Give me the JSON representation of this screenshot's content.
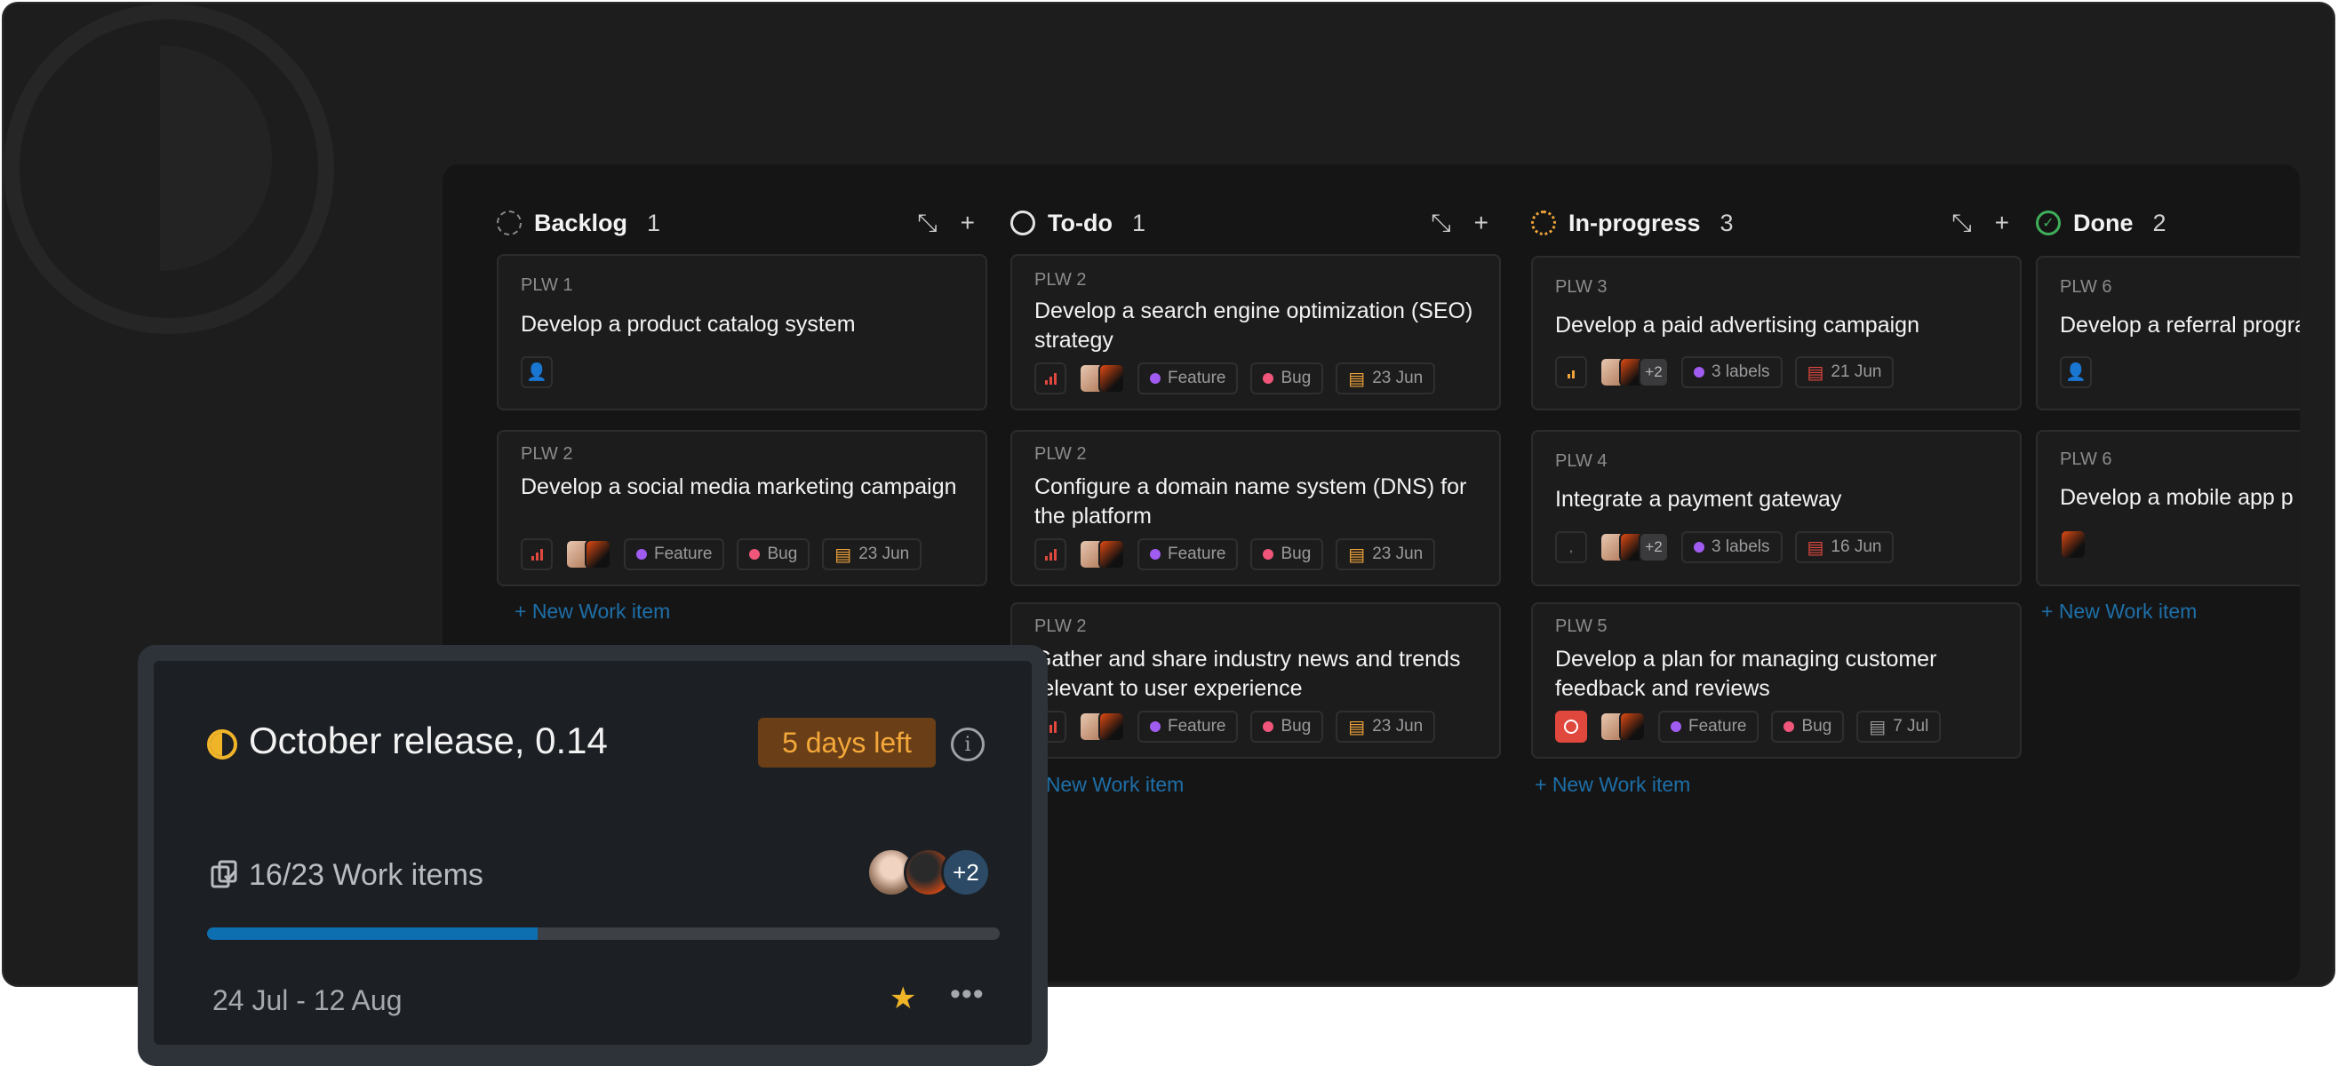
{
  "columns": [
    {
      "title": "Backlog",
      "count": "1",
      "state": "backlog",
      "cards": [
        {
          "id": "PLW 1",
          "title": "Develop a product catalog system"
        },
        {
          "id": "PLW 2",
          "title": "Develop a social media marketing campaign",
          "feature": "Feature",
          "bug": "Bug",
          "date": "23 Jun"
        }
      ],
      "new_item": "+ New Work item"
    },
    {
      "title": "To-do",
      "count": "1",
      "state": "todo",
      "cards": [
        {
          "id": "PLW 2",
          "title": "Develop a search engine optimization (SEO) strategy",
          "feature": "Feature",
          "bug": "Bug",
          "date": "23 Jun"
        },
        {
          "id": "PLW 2",
          "title": "Configure a domain name system (DNS) for the platform",
          "feature": "Feature",
          "bug": "Bug",
          "date": "23 Jun"
        },
        {
          "id": "PLW 2",
          "title": "Gather and share industry news and trends relevant to user experience",
          "feature": "Feature",
          "bug": "Bug",
          "date": "23 Jun"
        }
      ],
      "new_item": "+ New Work item"
    },
    {
      "title": "In-progress",
      "count": "3",
      "state": "inprogress",
      "cards": [
        {
          "id": "PLW 3",
          "title": "Develop a paid advertising campaign",
          "more": "+2",
          "labels": "3 labels",
          "date": "21 Jun"
        },
        {
          "id": "PLW 4",
          "title": "Integrate a payment gateway",
          "more": "+2",
          "labels": "3 labels",
          "date": "16 Jun"
        },
        {
          "id": "PLW 5",
          "title": "Develop a plan for managing customer feedback and reviews",
          "feature": "Feature",
          "bug": "Bug",
          "date": "7 Jul"
        }
      ],
      "new_item": "+ New Work item"
    },
    {
      "title": "Done",
      "count": "2",
      "state": "done",
      "cards": [
        {
          "id": "PLW 6",
          "title": "Develop a referral program"
        },
        {
          "id": "PLW 6",
          "title": "Develop a mobile app p"
        }
      ],
      "new_item": "+ New Work item"
    }
  ],
  "cycle": {
    "title": "October release, 0.14",
    "badge": "5 days left",
    "items_label": "16/23 Work items",
    "progress_fraction": 0.4174,
    "avatars_more": "+2",
    "dates": "24 Jul - 12 Aug"
  },
  "colors": {
    "feature": "#a05cf0",
    "bug": "#f0567a",
    "date_orange": "#f0a43a",
    "date_red": "#e0483e",
    "accent_blue": "#1e6fa8",
    "done_green": "#3fae5a",
    "inprogress_orange": "#f0a43a"
  }
}
